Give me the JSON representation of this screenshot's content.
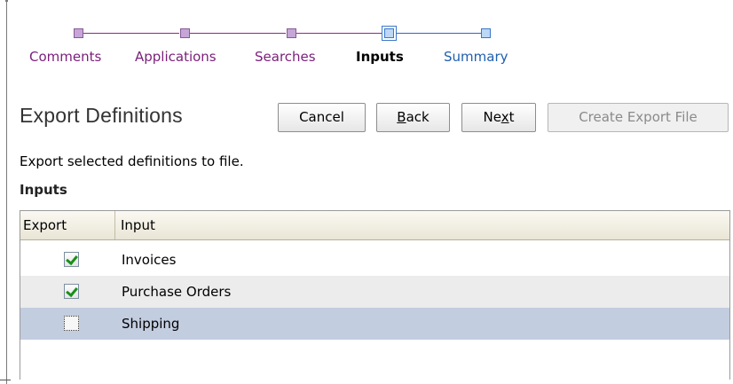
{
  "train": {
    "steps": [
      {
        "label": "Comments",
        "state": "visited"
      },
      {
        "label": "Applications",
        "state": "visited"
      },
      {
        "label": "Searches",
        "state": "visited"
      },
      {
        "label": "Inputs",
        "state": "current"
      },
      {
        "label": "Summary",
        "state": "future"
      }
    ]
  },
  "page": {
    "title": "Export Definitions",
    "subtitle": "Export selected definitions to file."
  },
  "toolbar": {
    "cancel_label": "Cancel",
    "back_label": "Back",
    "next_label": "Next",
    "create_label": "Create Export File"
  },
  "section": {
    "title": "Inputs"
  },
  "table": {
    "columns": [
      "Export",
      "Input"
    ],
    "rows": [
      {
        "export": true,
        "input": "Invoices"
      },
      {
        "export": true,
        "input": "Purchase Orders"
      },
      {
        "export": false,
        "input": "Shipping"
      }
    ]
  },
  "colors": {
    "visited": "#7a1f7a",
    "future": "#1f5fb0",
    "selected_row": "#c3cde0",
    "check": "#1a8f1a"
  }
}
